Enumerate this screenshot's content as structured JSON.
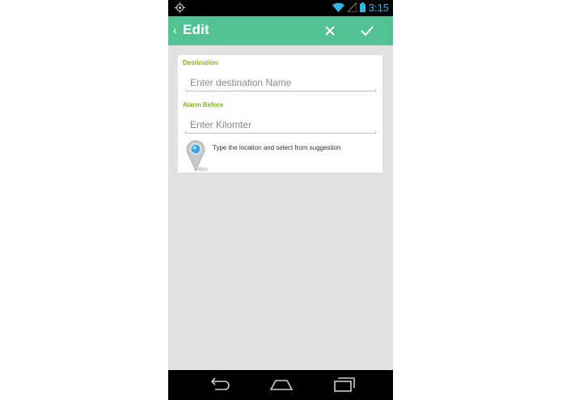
{
  "status_bar": {
    "time": "3:15",
    "icons": [
      "gps-icon",
      "wifi-icon",
      "signal-icon",
      "battery-icon"
    ]
  },
  "action_bar": {
    "title": "Edit",
    "icons": [
      "back-chevron-icon",
      "close-icon",
      "check-icon"
    ]
  },
  "form": {
    "destination_label": "Destination",
    "destination_placeholder": "Enter destination Name",
    "destination_value": "",
    "alarm_label": "Alarm Before",
    "alarm_placeholder": "Enter Kilomter",
    "alarm_value": "",
    "hint": "Type the location and select from suggestion",
    "hint_icon": "map-pin-icon"
  },
  "nav_bar": {
    "icons": [
      "back-icon",
      "home-icon",
      "recents-icon"
    ]
  },
  "colors": {
    "accent": "#52c193",
    "label": "#85b31c",
    "status_blue": "#33b5e5",
    "background": "#e1e1e1"
  }
}
